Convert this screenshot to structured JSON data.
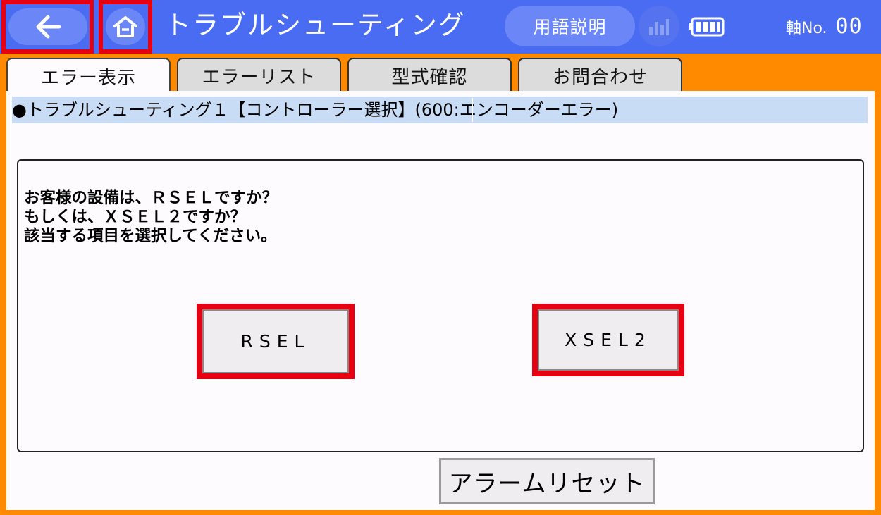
{
  "header": {
    "title": "トラブルシューティング",
    "glossary_label": "用語説明",
    "axis_label": "軸No.",
    "axis_value": "00",
    "back_icon": "arrow-left-icon",
    "home_icon": "home-icon",
    "chart_icon": "bar-chart-icon",
    "battery_icon": "battery-icon"
  },
  "tabs": [
    {
      "label": "エラー表示",
      "active": true
    },
    {
      "label": "エラーリスト",
      "active": false
    },
    {
      "label": "型式確認",
      "active": false
    },
    {
      "label": "お問合わせ",
      "active": false
    }
  ],
  "breadcrumb": {
    "text": "●トラブルシューティング１【コントローラー選択】(600:エンコーダーエラー)"
  },
  "question": {
    "line1": "お客様の設備は、ＲＳＥＬですか？",
    "line2": "もしくは、ＸＳＥＬ２ですか？",
    "line3": "該当する項目を選択してください。"
  },
  "choices": {
    "rsel": "RSEL",
    "xsel2": "XSEL2"
  },
  "footer": {
    "alarm_reset": "アラームリセット"
  },
  "colors": {
    "background": "#ff8a00",
    "header": "#4a6cf2",
    "highlight": "#e60012",
    "breadcrumb_bg": "#c9dcf5"
  }
}
